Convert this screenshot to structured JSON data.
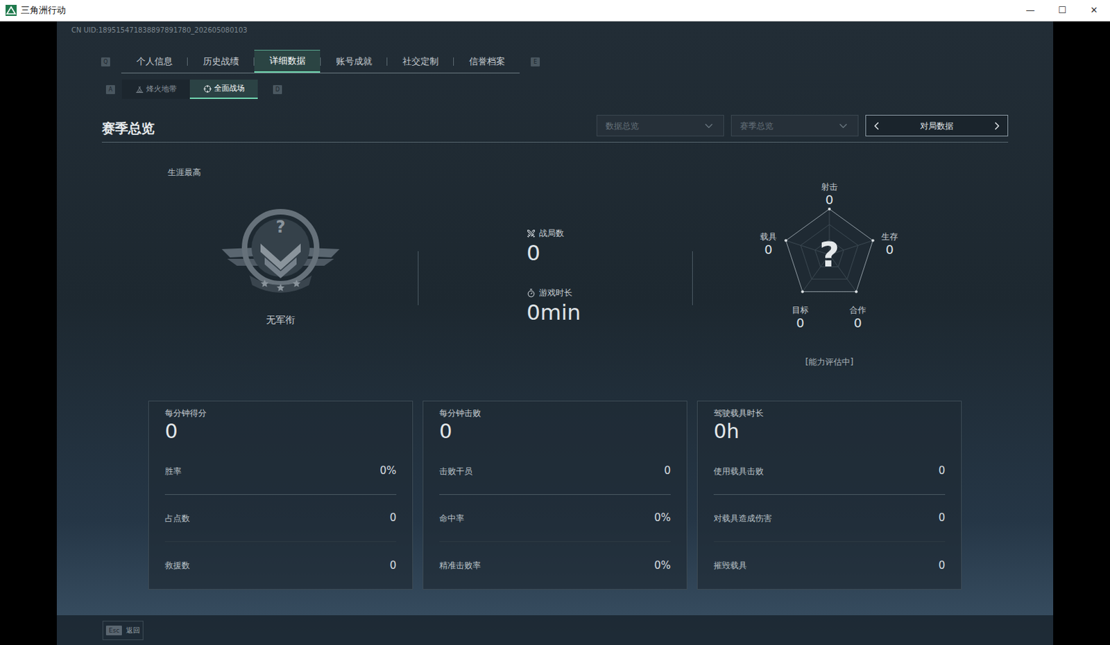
{
  "window": {
    "title": "三角洲行动",
    "controls": [
      "—",
      "☐",
      "✕"
    ]
  },
  "uid": "CN UID:189515471838897891780_202605080103",
  "tabs": {
    "prev_key": "Q",
    "next_key": "E",
    "items": [
      {
        "label": "个人信息",
        "selected": false
      },
      {
        "label": "历史战绩",
        "selected": false
      },
      {
        "label": "详细数据",
        "selected": true
      },
      {
        "label": "账号成就",
        "selected": false
      },
      {
        "label": "社交定制",
        "selected": false
      },
      {
        "label": "信誉档案",
        "selected": false
      }
    ]
  },
  "subtabs": {
    "prev_key": "A",
    "next_key": "D",
    "items": [
      {
        "label": "烽火地带",
        "selected": false,
        "kind": "extraction"
      },
      {
        "label": "全面战场",
        "selected": true,
        "kind": "warfare"
      }
    ]
  },
  "section_title": "赛季总览",
  "filters": [
    {
      "label": "数据总览",
      "disabled": true
    },
    {
      "label": "赛季总览",
      "disabled": true
    }
  ],
  "switcher": {
    "label": "对局数据"
  },
  "rank": {
    "caption": "生涯最高",
    "mark": "?",
    "name": "无军衔"
  },
  "summary": [
    {
      "label": "战局数",
      "value": "0",
      "kind": "matches"
    },
    {
      "label": "游戏时长",
      "value": "0min",
      "kind": "time"
    }
  ],
  "radar": {
    "center_mark": "?",
    "status": "[能力评估中]",
    "axes": [
      {
        "label": "射击",
        "value": "0",
        "level": 0
      },
      {
        "label": "生存",
        "value": "0",
        "level": 0
      },
      {
        "label": "合作",
        "value": "0",
        "level": 0
      },
      {
        "label": "目标",
        "value": "0",
        "level": 0
      },
      {
        "label": "载具",
        "value": "0",
        "level": 0
      }
    ]
  },
  "cards": [
    {
      "title": "每分钟得分",
      "value": "0",
      "rows": [
        {
          "label": "胜率",
          "value": "0%"
        },
        {
          "label": "占点数",
          "value": "0"
        },
        {
          "label": "救援数",
          "value": "0"
        }
      ]
    },
    {
      "title": "每分钟击败",
      "value": "0",
      "rows": [
        {
          "label": "击败干员",
          "value": "0"
        },
        {
          "label": "命中率",
          "value": "0%"
        },
        {
          "label": "精准击败率",
          "value": "0%"
        }
      ]
    },
    {
      "title": "驾驶载具时长",
      "value": "0h",
      "rows": [
        {
          "label": "使用载具击败",
          "value": "0"
        },
        {
          "label": "对载具造成伤害",
          "value": "0"
        },
        {
          "label": "摧毁载具",
          "value": "0"
        }
      ]
    }
  ],
  "footer": {
    "key": "Esc",
    "label": "返回"
  }
}
